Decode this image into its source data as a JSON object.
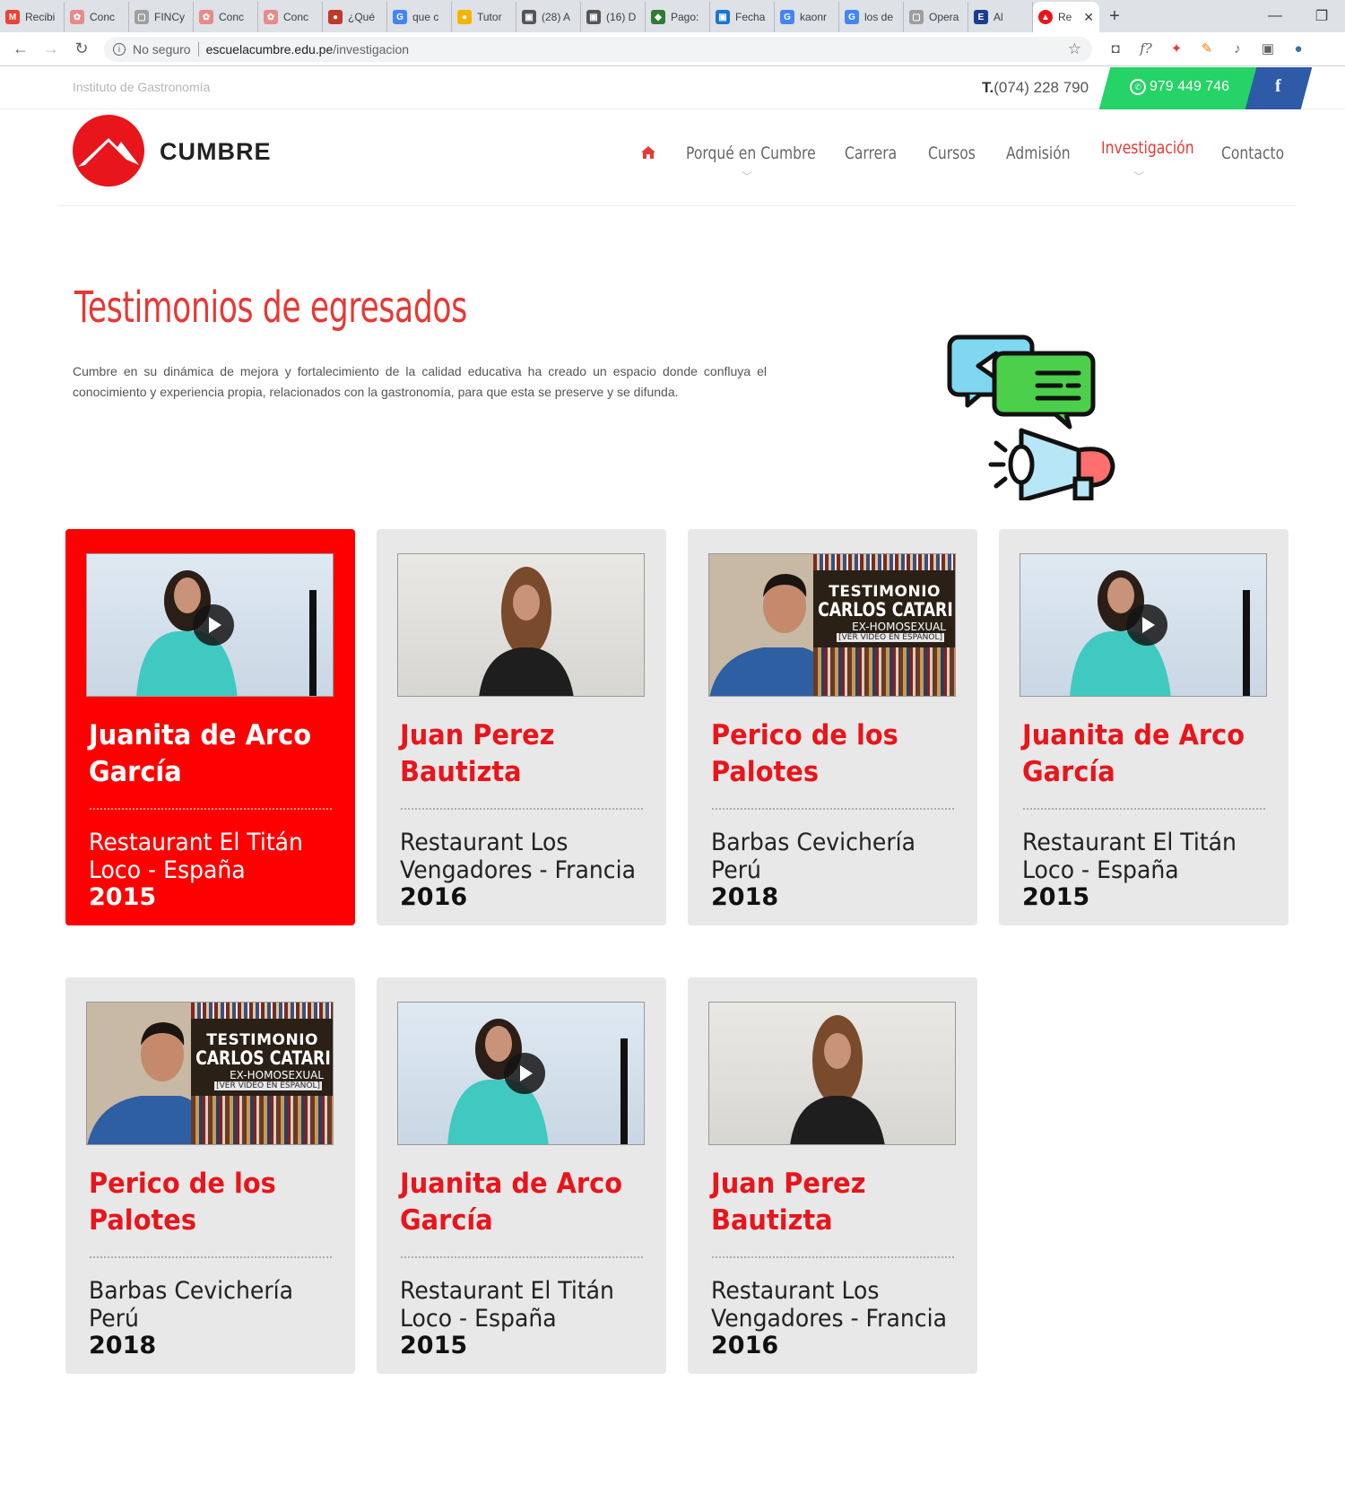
{
  "browser": {
    "tabs": [
      {
        "label": "Recibi",
        "color": "#ea4335",
        "glyph": "M"
      },
      {
        "label": "Conc",
        "color": "#e88a8a",
        "glyph": "✿"
      },
      {
        "label": "FINCy",
        "color": "#9e9e9e",
        "glyph": "▢"
      },
      {
        "label": "Conc",
        "color": "#e88a8a",
        "glyph": "✿"
      },
      {
        "label": "Conc",
        "color": "#e88a8a",
        "glyph": "✿"
      },
      {
        "label": "¿Qué",
        "color": "#c0392b",
        "glyph": "●"
      },
      {
        "label": "que c",
        "color": "#4285f4",
        "glyph": "G"
      },
      {
        "label": "Tutor",
        "color": "#f4b400",
        "glyph": "●"
      },
      {
        "label": "(28) A",
        "color": "#555555",
        "glyph": "▣"
      },
      {
        "label": "(16) D",
        "color": "#555555",
        "glyph": "▣"
      },
      {
        "label": "Pago:",
        "color": "#2e7d32",
        "glyph": "◆"
      },
      {
        "label": "Fecha",
        "color": "#1976d2",
        "glyph": "▣"
      },
      {
        "label": "kaonr",
        "color": "#4285f4",
        "glyph": "G"
      },
      {
        "label": "los de",
        "color": "#4285f4",
        "glyph": "G"
      },
      {
        "label": "Opera",
        "color": "#9e9e9e",
        "glyph": "▢"
      },
      {
        "label": "Al",
        "color": "#1a3d8f",
        "glyph": "E"
      }
    ],
    "active_tab": {
      "label": "Re",
      "color": "#e8151b"
    },
    "new_tab": "+",
    "window": {
      "minimize": "—",
      "restore": "❐"
    },
    "security": "No seguro",
    "url_host": "escuelacumbre.edu.pe",
    "url_path": "/investigacion"
  },
  "topbar": {
    "tagline": "Instituto de Gastronomía",
    "phone_prefix": "T.",
    "phone": "(074) 228 790",
    "whatsapp": "979 449 746",
    "facebook": "f",
    "whatsapp_color": "#25d366",
    "facebook_color": "#2e5aa8"
  },
  "brand": {
    "name": "CUMBRE",
    "color": "#e8151b"
  },
  "nav": {
    "items": [
      "Porqué en Cumbre",
      "Carrera",
      "Cursos",
      "Admisión",
      "Investigación",
      "Contacto"
    ],
    "active": "Investigación"
  },
  "hero": {
    "title": "Testimonios de egresados",
    "description": "Cumbre en su dinámica de mejora y fortalecimiento de la calidad educativa ha creado un espacio donde confluya el conocimiento y experiencia propia, relacionados con la gastronomía, para que esta se preserve y se difunda."
  },
  "video_overlay": {
    "line1": "TESTIMONIO",
    "line2": "CARLOS CATARI",
    "line3": "EX-HOMOSEXUAL",
    "line4": "[VER VIDEO EN ESPAÑOL]"
  },
  "testimonials": [
    {
      "name": "Juanita de Arco García",
      "place": "Restaurant El Titán Loco - España",
      "year": "2015"
    },
    {
      "name": "Juan Perez Bautizta",
      "place": "Restaurant Los Vengadores - Francia",
      "year": "2016"
    },
    {
      "name": "Perico de los Palotes",
      "place": "Barbas Cevichería Perú",
      "year": "2018"
    },
    {
      "name": "Juanita de Arco García",
      "place": "Restaurant El Titán Loco - España",
      "year": "2015"
    },
    {
      "name": "Perico de los Palotes",
      "place": "Barbas Cevichería Perú",
      "year": "2018"
    },
    {
      "name": "Juanita de Arco García",
      "place": "Restaurant El Titán Loco - España",
      "year": "2015"
    },
    {
      "name": "Juan Perez Bautizta",
      "place": "Restaurant Los Vengadores - Francia",
      "year": "2016"
    }
  ],
  "highlight_color": "#ff0000"
}
